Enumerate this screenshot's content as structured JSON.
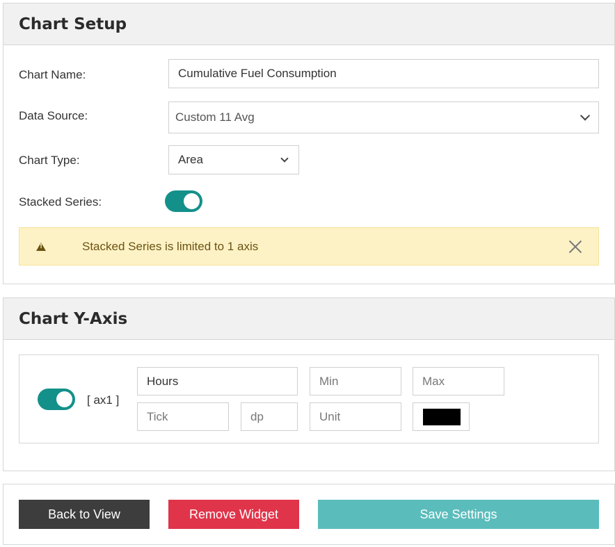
{
  "setup": {
    "title": "Chart Setup",
    "chart_name_label": "Chart Name:",
    "chart_name_value": "Cumulative Fuel Consumption",
    "data_source_label": "Data Source:",
    "data_source_value": "Custom 11 Avg",
    "chart_type_label": "Chart Type:",
    "chart_type_value": "Area",
    "stacked_label": "Stacked Series:",
    "stacked_enabled": true,
    "alert_text": "Stacked Series is limited to 1 axis"
  },
  "yaxis": {
    "title": "Chart Y-Axis",
    "axis_enabled": true,
    "axis_id": "[ ax1 ]",
    "label_value": "Hours",
    "min_placeholder": "Min",
    "max_placeholder": "Max",
    "tick_placeholder": "Tick",
    "dp_placeholder": "dp",
    "unit_placeholder": "Unit",
    "color": "#000000"
  },
  "actions": {
    "back_label": "Back to View",
    "remove_label": "Remove Widget",
    "save_label": "Save Settings"
  },
  "colors": {
    "toggle_on": "#14908a",
    "danger": "#e0344a",
    "primary": "#5bbcbc",
    "dark": "#3d3d3d",
    "warning_bg": "#fdf2c6"
  }
}
